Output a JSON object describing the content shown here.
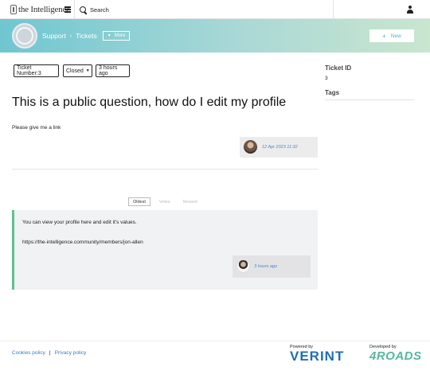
{
  "header": {
    "logo_text": "the Intelligence",
    "search_label": "Search"
  },
  "banner": {
    "breadcrumb": [
      "Support",
      "Tickets"
    ],
    "more_label": "More",
    "new_label": "New"
  },
  "ticket": {
    "number_label": "Ticket Number:3",
    "status": "Closed",
    "age": "3 hours ago",
    "title": "This is a public question, how do I edit my profile",
    "body": "Please give me a link",
    "posted": "12 Apr 2023 11:32"
  },
  "sort": {
    "tabs": [
      "Oldest",
      "Votes",
      "Newest"
    ],
    "active": "Oldest"
  },
  "answer": {
    "line1": "You can view your profile here and edit it's values.",
    "line2": "https://the-intelligence.community/members/jon-allen",
    "posted": "3 hours ago"
  },
  "sidebar": {
    "ticket_id_label": "Ticket ID",
    "ticket_id_value": "3",
    "tags_label": "Tags"
  },
  "footer": {
    "cookies_label": "Cookies policy",
    "separator": "|",
    "privacy_label": "Privacy policy",
    "powered_by": "Powered by",
    "verint": "VERINT",
    "developed_by": "Developed by",
    "fourroads": "4ROADS"
  },
  "colors": {
    "accent_link": "#3a7cc4",
    "answer_border": "#5cc58b",
    "verint_blue": "#1e6fb5",
    "fourroads_green": "#56b7a0"
  }
}
